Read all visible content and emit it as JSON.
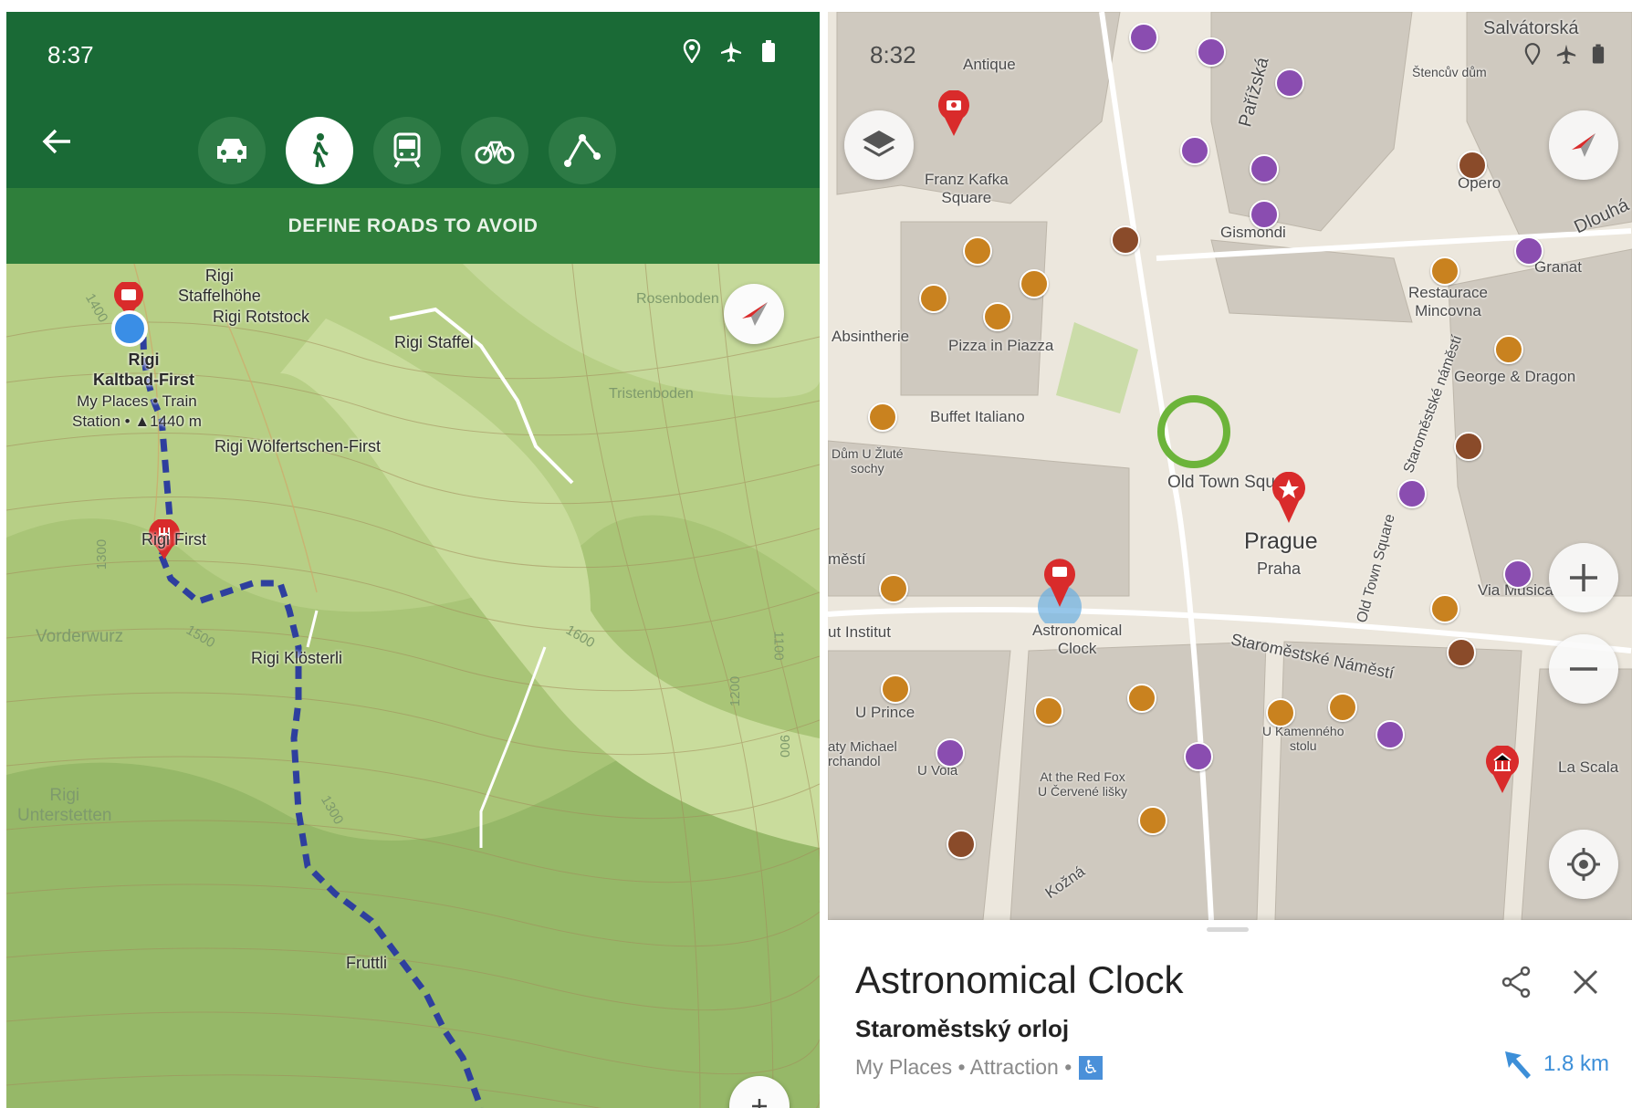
{
  "left": {
    "status_time": "8:37",
    "status_icons": [
      "location-icon",
      "airplane-icon",
      "battery-icon"
    ],
    "transport_modes": [
      {
        "name": "car",
        "icon": "car-icon",
        "active": false
      },
      {
        "name": "walk",
        "icon": "walk-icon",
        "active": true
      },
      {
        "name": "transit",
        "icon": "train-icon",
        "active": false
      },
      {
        "name": "bicycle",
        "icon": "bicycle-icon",
        "active": false
      },
      {
        "name": "route-planner",
        "icon": "route-icon",
        "active": false
      }
    ],
    "define_roads": "DEFINE ROADS TO AVOID",
    "map_labels": {
      "staffelhohe": "Rigi\nStaffelhöhe",
      "rotstock": "Rigi Rotstock",
      "staffel": "Rigi Staffel",
      "kaltbad": "Rigi\nKaltbad-First",
      "kaltbad_meta": "My Places • Train\nStation • ▲1440 m",
      "wolfertschen": "Rigi Wölfertschen-First",
      "first": "Rigi First",
      "klosterli": "Rigi Klösterli",
      "vorderwurz": "Vorderwurz",
      "unterstetten": "Rigi\nUnterstetten",
      "fruttli": "Fruttli",
      "tristenboden": "Tristenboden",
      "rosenboden": "Rosenboden"
    },
    "contours": [
      "1400",
      "1300",
      "1500",
      "1600",
      "1300",
      "1200",
      "1100",
      "900"
    ]
  },
  "right": {
    "status_time": "8:32",
    "status_icons": [
      "location-icon",
      "airplane-icon",
      "battery-icon"
    ],
    "map_labels": {
      "salvatorska": "Salvátorská",
      "stencuv": "Štencův dům",
      "antique": "Antique",
      "parizska": "Pařížská",
      "franz_kafka": "Franz Kafka\nSquare",
      "opero": "Opero",
      "gismondi": "Gismondi",
      "granat": "Granat",
      "dlouha": "Dlouhá",
      "restaurace": "Restaurace\nMincovna",
      "absintherie": "Absintherie",
      "pizza": "Pizza in Piazza",
      "george": "George & Dragon",
      "buffet": "Buffet Italiano",
      "dum_u_zlute": "Dům U Žluté\nsochy",
      "old_town_square": "Old Town Square",
      "staromestske_namesti": "Staroměstské náměstí",
      "prague": "Prague",
      "praha": "Praha",
      "old_town_square_v": "Old Town Square",
      "via_musica": "Via Musica",
      "astro_label": "Astronomical\nClock",
      "institut": "ut Institut",
      "staromestske_n2": "Staroměstské Náměstí",
      "u_prince": "U Prince",
      "michael": "aty Michael\nrchandol",
      "u_vola": "U Vola",
      "red_fox": "At the Red Fox\nU Červené lišky",
      "kamenneho": "U Kamenného\nstolu",
      "la_scala": "La Scala",
      "kozna": "Kožná",
      "mesti": "městí"
    },
    "place": {
      "title": "Astronomical Clock",
      "subtitle": "Staroměstský orloj",
      "meta": "My Places • Attraction •",
      "distance": "1.8 km"
    },
    "colors": {
      "accent": "#3d8fd8",
      "green_bar": "#1a6a36",
      "marker_red": "#d92b2b"
    }
  }
}
